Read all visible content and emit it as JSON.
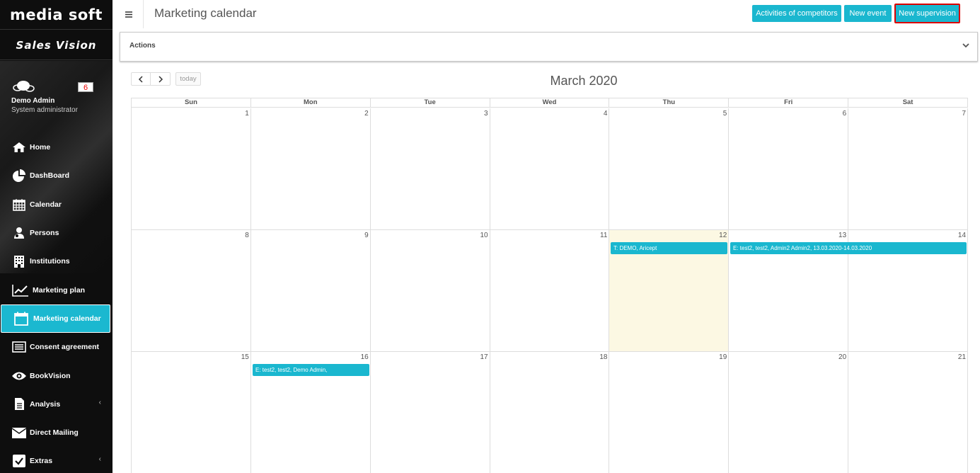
{
  "sidebar": {
    "logo": "media soft",
    "app_name": "Sales Vision",
    "notification_count": "6",
    "user_name": "Demo Admin",
    "user_role": "System administrator",
    "items": [
      {
        "label": "Home",
        "icon": "home-icon"
      },
      {
        "label": "DashBoard",
        "icon": "pie-chart-icon"
      },
      {
        "label": "Calendar",
        "icon": "calendar-grid-icon"
      },
      {
        "label": "Persons",
        "icon": "persons-icon"
      },
      {
        "label": "Institutions",
        "icon": "building-icon"
      },
      {
        "label": "Marketing plan",
        "icon": "line-chart-icon"
      },
      {
        "label": "Marketing calendar",
        "icon": "calendar-icon",
        "active": true
      },
      {
        "label": "Consent agreement",
        "icon": "list-icon"
      },
      {
        "label": "BookVision",
        "icon": "eye-icon"
      },
      {
        "label": "Analysis",
        "icon": "document-icon",
        "has_submenu": true
      },
      {
        "label": "Direct Mailing",
        "icon": "envelope-icon"
      },
      {
        "label": "Extras",
        "icon": "checkbox-icon",
        "has_submenu": true
      }
    ],
    "submenu_glyph": "‹",
    "accent_color": "#1bb8d0"
  },
  "header": {
    "title": "Marketing calendar",
    "buttons": {
      "competitors": "Activities of competitors",
      "new_event": "New event",
      "new_supervision": "New supervision"
    }
  },
  "actions_panel": {
    "label": "Actions"
  },
  "calendar": {
    "title": "March 2020",
    "today_label": "today",
    "weekdays": [
      "Sun",
      "Mon",
      "Tue",
      "Wed",
      "Thu",
      "Fri",
      "Sat"
    ],
    "weeks": [
      [
        "1",
        "2",
        "3",
        "4",
        "5",
        "6",
        "7"
      ],
      [
        "8",
        "9",
        "10",
        "11",
        "12",
        "13",
        "14"
      ],
      [
        "15",
        "16",
        "17",
        "18",
        "19",
        "20",
        "21"
      ]
    ],
    "today_date": "12",
    "events": [
      {
        "text": "T: DEMO, Aricept",
        "start_day": "12",
        "end_day": "12"
      },
      {
        "text": "E: test2, test2, Admin2 Admin2, 13.03.2020-14.03.2020",
        "start_day": "13",
        "end_day": "14"
      },
      {
        "text": "E: test2, test2, Demo Admin,",
        "start_day": "16",
        "end_day": "16"
      }
    ],
    "event_color": "#1ab7cf",
    "today_color": "#fcf8e3"
  }
}
